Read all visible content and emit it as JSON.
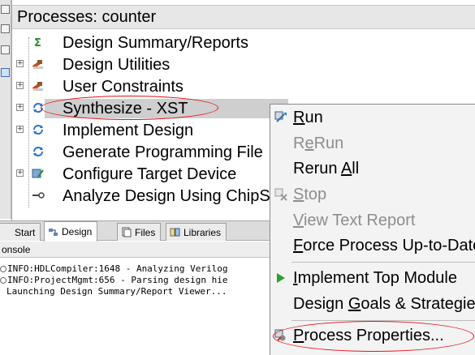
{
  "processes_panel": {
    "title": "Processes: counter",
    "items": [
      {
        "label": "Design Summary/Reports",
        "icon": "sigma-icon",
        "expandable": false
      },
      {
        "label": "Design Utilities",
        "icon": "tools-icon",
        "expandable": true
      },
      {
        "label": "User Constraints",
        "icon": "tools-icon",
        "expandable": true
      },
      {
        "label": "Synthesize - XST",
        "icon": "refresh-icon",
        "expandable": true,
        "selected": true
      },
      {
        "label": "Implement Design",
        "icon": "refresh-icon",
        "expandable": true
      },
      {
        "label": "Generate Programming File",
        "icon": "refresh-icon",
        "expandable": false
      },
      {
        "label": "Configure Target Device",
        "icon": "device-icon",
        "expandable": true
      },
      {
        "label": "Analyze Design Using ChipScope",
        "icon": "probe-icon",
        "expandable": false
      }
    ]
  },
  "tabs": [
    {
      "label": "Start",
      "icon": "start-icon",
      "active": false
    },
    {
      "label": "Design",
      "icon": "design-icon",
      "active": true
    },
    {
      "label": "Files",
      "icon": "files-icon",
      "active": false
    },
    {
      "label": "Libraries",
      "icon": "libraries-icon",
      "active": false
    }
  ],
  "console": {
    "title": "onsole",
    "lines": [
      "INFO:HDLCompiler:1648 - Analyzing Verilog",
      "INFO:ProjectMgmt:656 - Parsing design hie",
      "Launching Design Summary/Report Viewer..."
    ]
  },
  "context_menu": {
    "items": [
      {
        "label_pre": "",
        "label_u": "R",
        "label_post": "un",
        "disabled": false,
        "icon": "run-icon"
      },
      {
        "label_pre": "R",
        "label_u": "e",
        "label_post": "Run",
        "disabled": true,
        "icon": ""
      },
      {
        "label_pre": "Rerun ",
        "label_u": "A",
        "label_post": "ll",
        "disabled": false,
        "icon": ""
      },
      {
        "label_pre": "",
        "label_u": "S",
        "label_post": "top",
        "disabled": true,
        "icon": "stop-icon"
      },
      {
        "label_pre": "",
        "label_u": "V",
        "label_post": "iew Text Report",
        "disabled": true,
        "icon": ""
      },
      {
        "label_pre": "",
        "label_u": "F",
        "label_post": "orce Process Up-to-Date",
        "disabled": false,
        "icon": ""
      },
      {
        "label_pre": "",
        "label_u": "I",
        "label_post": "mplement Top Module",
        "disabled": false,
        "icon": "play-icon"
      },
      {
        "label_pre": "Design ",
        "label_u": "G",
        "label_post": "oals & Strategies",
        "disabled": false,
        "icon": ""
      },
      {
        "label_pre": "",
        "label_u": "P",
        "label_post": "rocess Properties...",
        "disabled": false,
        "icon": "properties-icon"
      }
    ]
  },
  "colors": {
    "annotation": "#e0141a",
    "play_green": "#2ea02e",
    "refresh_blue": "#2b73c9"
  }
}
